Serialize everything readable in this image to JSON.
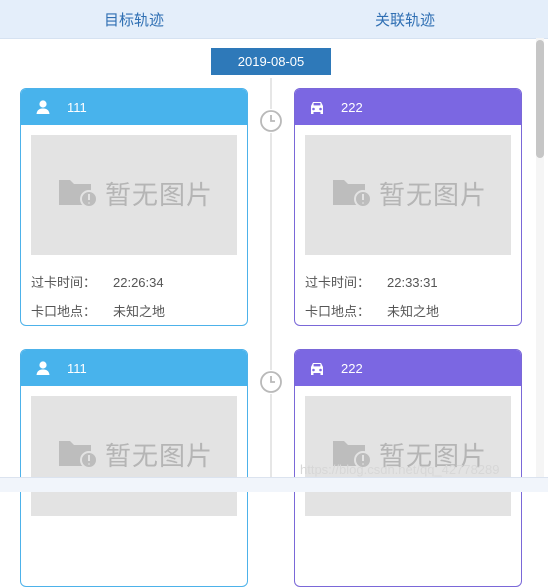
{
  "tabs": {
    "left": "目标轨迹",
    "right": "关联轨迹"
  },
  "date": "2019-08-05",
  "cards": [
    {
      "id": "111",
      "type": "person",
      "placeholder": "暂无图片",
      "time_label": "过卡时间：",
      "time": "22:26:34",
      "place_label": "卡口地点：",
      "place": "未知之地"
    },
    {
      "id": "222",
      "type": "vehicle",
      "placeholder": "暂无图片",
      "time_label": "过卡时间：",
      "time": "22:33:31",
      "place_label": "卡口地点：",
      "place": "未知之地"
    },
    {
      "id": "111",
      "type": "person",
      "placeholder": "暂无图片"
    },
    {
      "id": "222",
      "type": "vehicle",
      "placeholder": "暂无图片"
    }
  ],
  "watermark": "https://blog.csdn.net/qq_42778289",
  "colors": {
    "blue_card": "#48b3ec",
    "purple_card": "#7b67e2",
    "date_badge": "#2e79b9",
    "header_bg": "#e4eefa"
  }
}
